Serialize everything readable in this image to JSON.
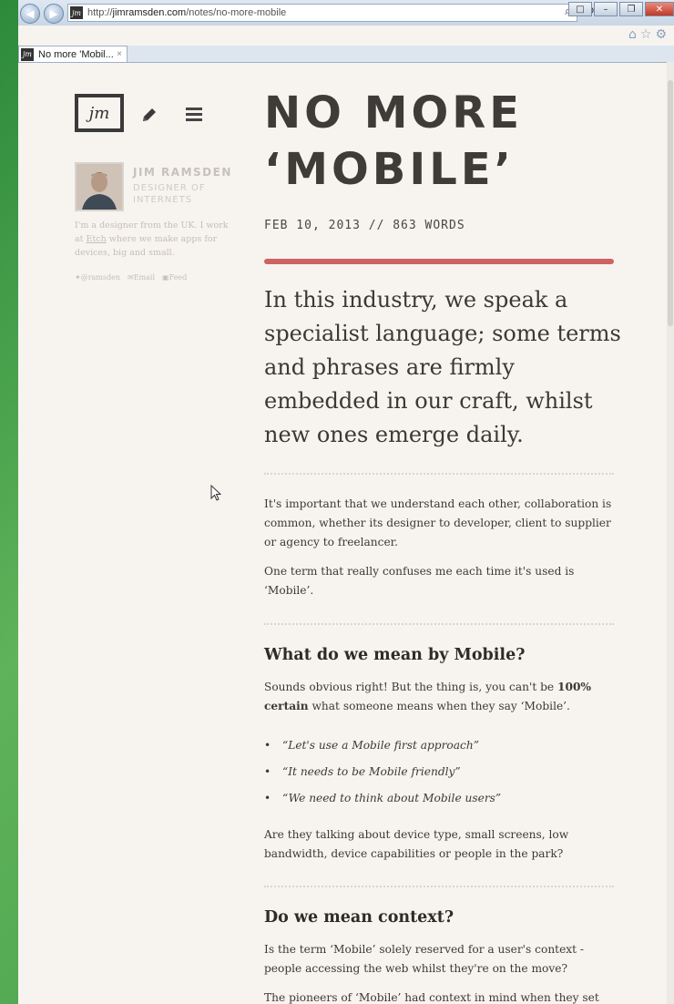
{
  "browser": {
    "url_prefix": "http://",
    "url_domain": "jimramsden.com",
    "url_path": "/notes/no-more-mobile",
    "tab_title": "No more 'Mobil...",
    "favicon_text": "jm",
    "addr_tools": "⌕ ▾ ↻ ✕",
    "tab_close": "×"
  },
  "sidebar": {
    "logo_text": "jm",
    "author_name": "JIM RAMSDEN",
    "author_role": "DESIGNER OF INTERNETS",
    "bio_before": "I'm a designer from the UK. I work at ",
    "bio_link": "Etch",
    "bio_after": " where we make apps for devices, big and small.",
    "social": [
      "@ramsden",
      "Email",
      "Feed"
    ]
  },
  "post": {
    "title": "NO MORE ‘MOBILE’",
    "meta": "FEB 10, 2013 // 863 WORDS",
    "lede": "In this industry, we speak a specialist language; some terms and phrases are firmly embedded in our craft, whilst new ones emerge daily.",
    "para1": "It's important that we understand each other, collaboration is common, whether its designer to developer, client to supplier or agency to freelancer.",
    "para2": "One term that really confuses me each time it's used is ‘Mobile’.",
    "h2_1": "What do we mean by Mobile?",
    "para3_before": "Sounds obvious right! But the thing is, you can't be ",
    "para3_bold": "100% certain",
    "para3_after": " what someone means when they say ‘Mobile’.",
    "bullets": [
      "“Let's use a Mobile first approach”",
      "“It needs to be Mobile friendly”",
      "“We need to think about Mobile users”"
    ],
    "para4": "Are they talking about device type, small screens, low bandwidth, device capabilities or people in the park?",
    "h2_2": "Do we mean context?",
    "para5": "Is the term ‘Mobile’ solely reserved for a user's context - people accessing the web whilst they're on the move?",
    "para6": "The pioneers of ‘Mobile’ had context in mind when they set"
  }
}
